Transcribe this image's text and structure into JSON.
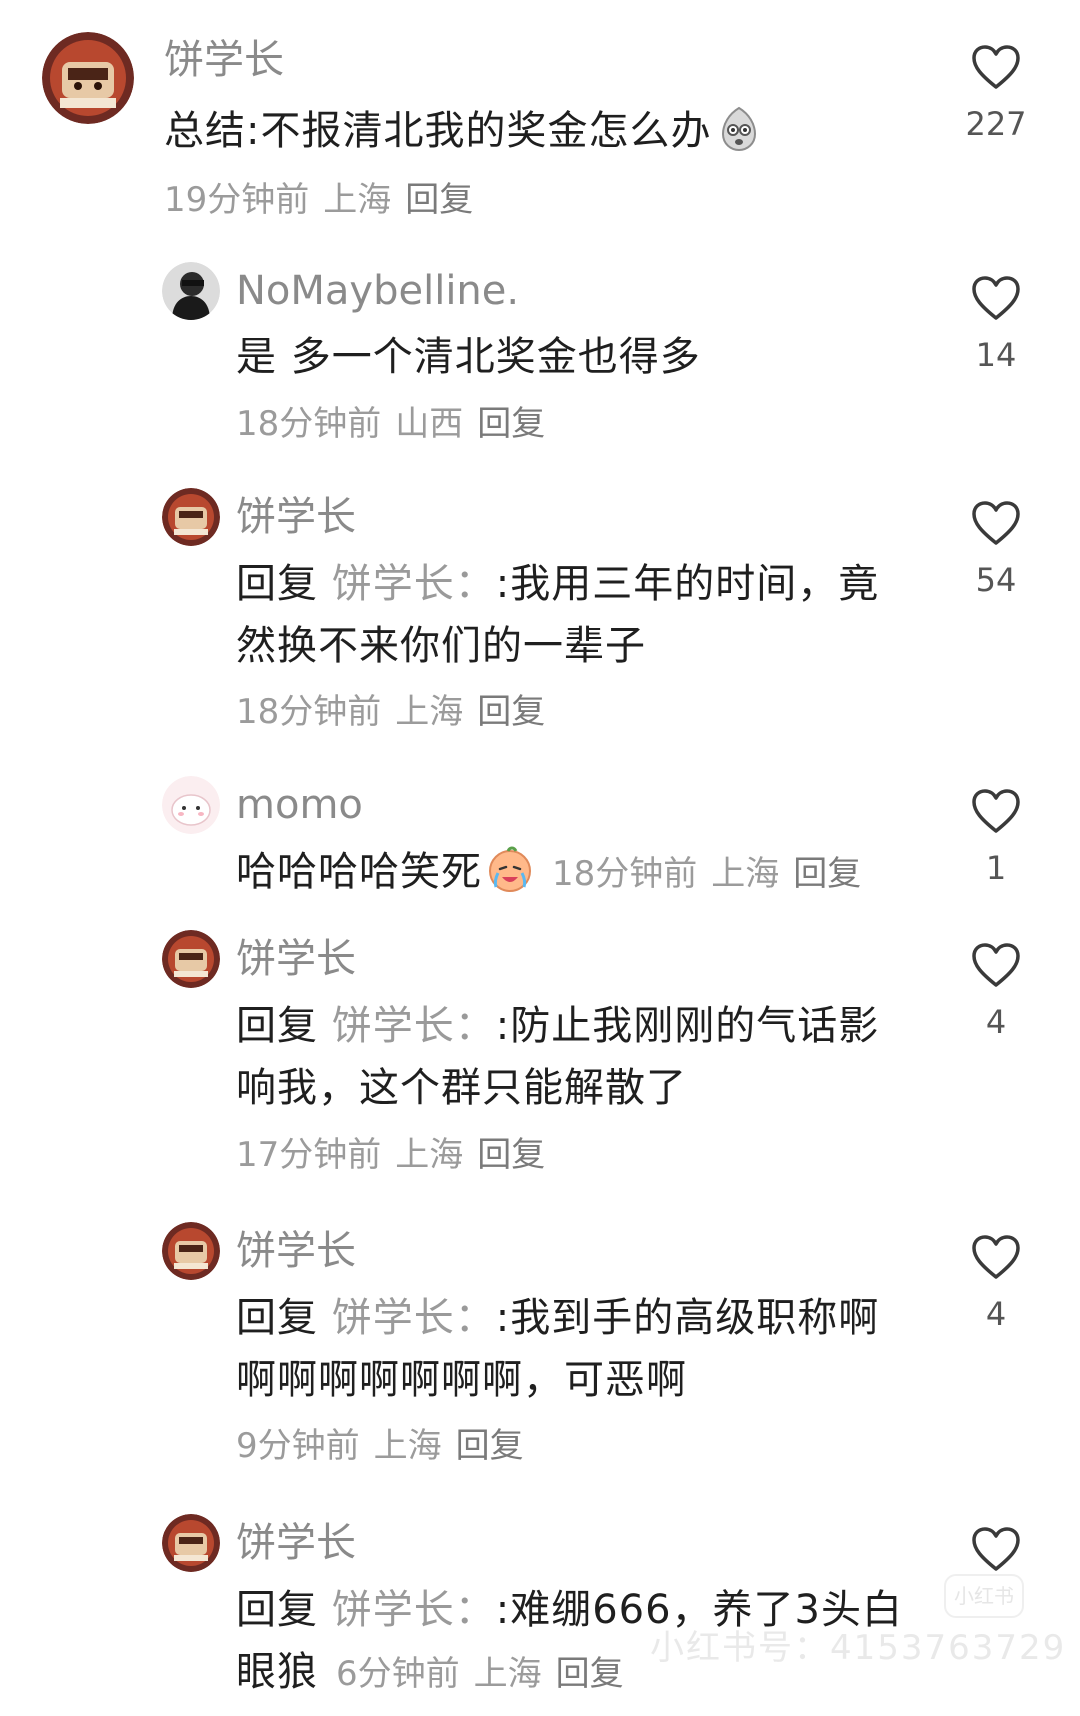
{
  "comments": [
    {
      "username": "饼学长",
      "text": "总结:不报清北我的奖金怎么办",
      "emoji": "cold-sweat-emoji",
      "time": "19分钟前",
      "location": "上海",
      "reply_label": "回复",
      "likes": "227"
    },
    {
      "username": "NoMaybelline.",
      "text": "是 多一个清北奖金也得多",
      "time": "18分钟前",
      "location": "山西",
      "reply_label": "回复",
      "likes": "14"
    },
    {
      "username": "饼学长",
      "reply_prefix": "回复",
      "reply_target": "饼学长：",
      "text": ":我用三年的时间，竟然换不来你们的一辈子",
      "time": "18分钟前",
      "location": "上海",
      "reply_label": "回复",
      "likes": "54"
    },
    {
      "username": "momo",
      "text": "哈哈哈哈笑死",
      "emoji": "crying-laughing-emoji",
      "time": "18分钟前",
      "location": "上海",
      "reply_label": "回复",
      "likes": "1"
    },
    {
      "username": "饼学长",
      "reply_prefix": "回复",
      "reply_target": "饼学长：",
      "text": ":防止我刚刚的气话影响我，这个群只能解散了",
      "time": "17分钟前",
      "location": "上海",
      "reply_label": "回复",
      "likes": "4"
    },
    {
      "username": "饼学长",
      "reply_prefix": "回复",
      "reply_target": "饼学长：",
      "text": ":我到手的高级职称啊啊啊啊啊啊啊啊，可恶啊",
      "time": "9分钟前",
      "location": "上海",
      "reply_label": "回复",
      "likes": "4"
    },
    {
      "username": "饼学长",
      "reply_prefix": "回复",
      "reply_target": "饼学长：",
      "text": ":难绷666，养了3头白眼狼",
      "time": "6分钟前",
      "location": "上海",
      "reply_label": "回复",
      "likes": ""
    }
  ],
  "watermark": {
    "logo": "小红书",
    "text": "小红书号：4153763729"
  },
  "colors": {
    "background": "#ffffff",
    "username": "#8a8a8a",
    "text": "#1f1f1f",
    "meta": "#9b9b9b",
    "heart_stroke": "#3a3a3a"
  }
}
